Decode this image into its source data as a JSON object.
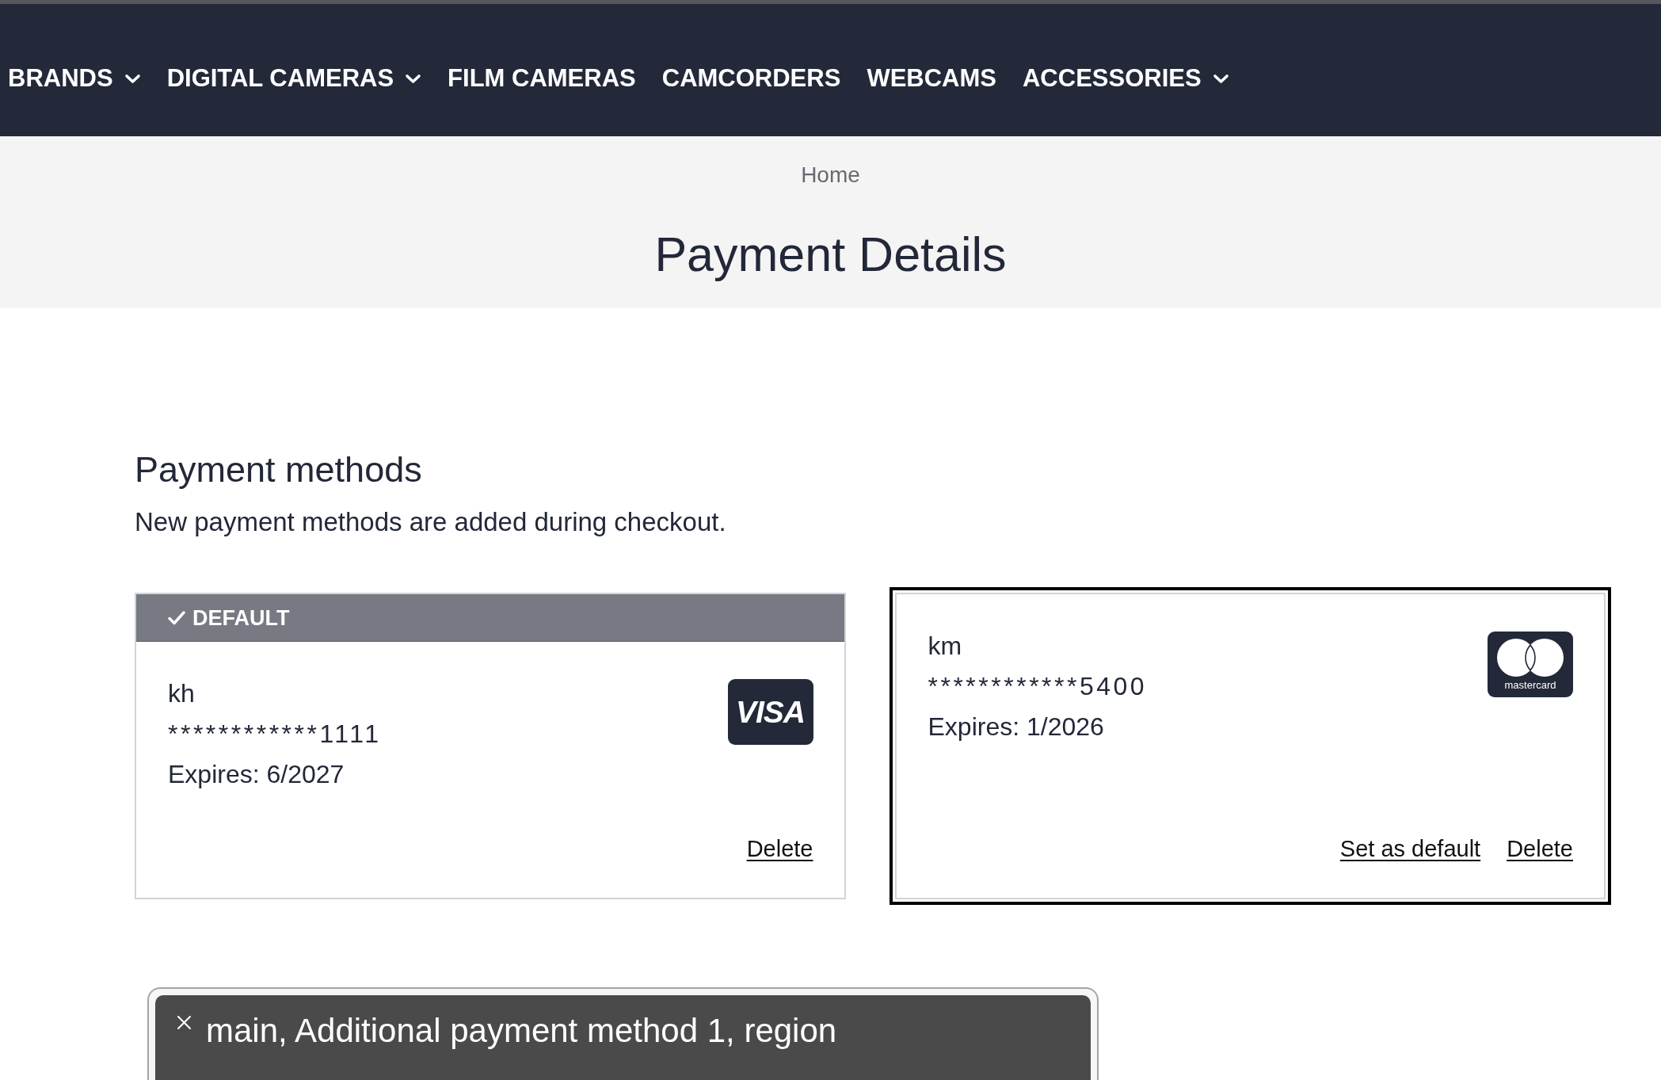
{
  "nav": {
    "items": [
      {
        "label": "BRANDS",
        "dropdown": true
      },
      {
        "label": "DIGITAL CAMERAS",
        "dropdown": true
      },
      {
        "label": "FILM CAMERAS",
        "dropdown": false
      },
      {
        "label": "CAMCORDERS",
        "dropdown": false
      },
      {
        "label": "WEBCAMS",
        "dropdown": false
      },
      {
        "label": "ACCESSORIES",
        "dropdown": true
      }
    ]
  },
  "breadcrumb": [
    {
      "label": "Home"
    }
  ],
  "page_title": "Payment Details",
  "payment_methods": {
    "title": "Payment methods",
    "description": "New payment methods are added during checkout.",
    "cards": [
      {
        "is_default": true,
        "badge": "DEFAULT",
        "focused": false,
        "holder": "kh",
        "number": "************1111",
        "expires": "Expires: 6/2027",
        "brand": {
          "kind": "visa",
          "text": "VISA"
        },
        "actions": [
          {
            "label": "Delete"
          }
        ]
      },
      {
        "is_default": false,
        "focused": true,
        "holder": "km",
        "number": "************5400",
        "expires": "Expires: 1/2026",
        "brand": {
          "kind": "mastercard",
          "text": "mastercard"
        },
        "actions": [
          {
            "label": "Set as default"
          },
          {
            "label": "Delete"
          }
        ]
      }
    ]
  },
  "caption_panel": {
    "text": "main, Additional payment method 1, region"
  }
}
